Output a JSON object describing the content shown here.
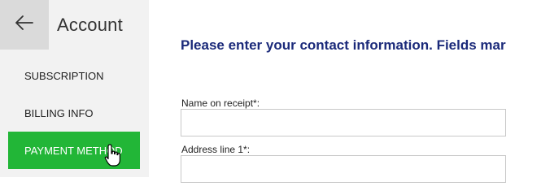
{
  "sidebar": {
    "back_icon": "arrow-left-icon",
    "title": "Account",
    "items": [
      {
        "label": "SUBSCRIPTION"
      },
      {
        "label": "BILLING INFO"
      },
      {
        "label": "PAYMENT METHOD",
        "active": true
      }
    ]
  },
  "main": {
    "heading": "Please enter your contact information. Fields mar",
    "fields": [
      {
        "label": "Name on receipt*:",
        "value": ""
      },
      {
        "label": "Address line 1*:",
        "value": ""
      }
    ]
  },
  "colors": {
    "active_nav": "#22b637",
    "heading": "#1b2a7a",
    "sidebar_bg": "#f2f2f2"
  }
}
